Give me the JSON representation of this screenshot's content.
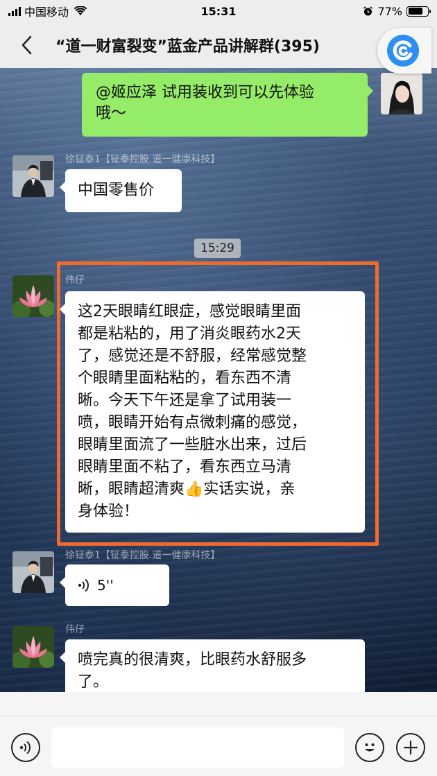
{
  "status_bar": {
    "carrier": "中国移动",
    "time": "15:31",
    "battery": "77%",
    "battery_level": 0.77
  },
  "nav": {
    "title": "“道一财富裂变”蓝金产品讲解群(395)"
  },
  "messages": [
    {
      "side": "right",
      "type": "text",
      "text": "@姬应泽 试用装收到可以先体验哦～",
      "lines": [
        "@姬应泽 试用装收到可以先体验",
        "哦～"
      ]
    },
    {
      "side": "left",
      "sender": "徐钲泰1【钲泰控股.道一健康科技】",
      "type": "text",
      "text": "中国零售价"
    },
    {
      "type": "time",
      "text": "15:29"
    },
    {
      "side": "left",
      "sender": "伟仔",
      "type": "text",
      "highlighted": true,
      "lines": [
        "这2天眼睛红眼症，感觉眼睛里面",
        "都是粘粘的，用了消炎眼药水2天",
        "了，感觉还是不舒服，经常感觉整",
        "个眼睛里面粘粘的，看东西不清",
        "晰。今天下午还是拿了试用装一",
        "喷，眼睛开始有点微刺痛的感觉，",
        "眼睛里面流了一些脏水出来，过后",
        "眼睛里面不粘了，看东西立马清",
        "晰，眼睛超清爽👍实话实说，亲",
        "身体验！"
      ]
    },
    {
      "side": "left",
      "sender": "徐钲泰1【钲泰控股.道一健康科技】",
      "type": "voice",
      "duration": "5''"
    },
    {
      "side": "left",
      "sender": "伟仔",
      "type": "text",
      "lines": [
        "喷完真的很清爽，比眼药水舒服多",
        "了。"
      ]
    }
  ],
  "colors": {
    "nav_bg": "#ededed",
    "green_bubble": "#95ec69",
    "highlight_border": "#ef6a2c"
  },
  "icons": [
    "back-icon",
    "floating-app-icon",
    "voice-icon",
    "emoji-icon",
    "plus-icon"
  ]
}
